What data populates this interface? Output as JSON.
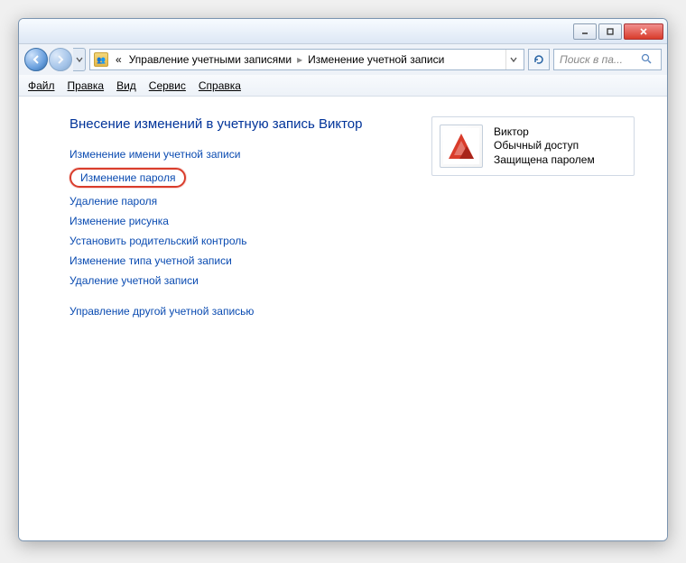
{
  "window_controls": {
    "minimize": "min",
    "maximize": "max",
    "close": "close"
  },
  "breadcrumb": {
    "prefix": "«",
    "item1": "Управление учетными записями",
    "item2": "Изменение учетной записи"
  },
  "search": {
    "placeholder": "Поиск в па..."
  },
  "menu": {
    "file": "Файл",
    "edit": "Правка",
    "view": "Вид",
    "tools": "Сервис",
    "help": "Справка"
  },
  "page": {
    "heading": "Внесение изменений в учетную запись Виктор",
    "links": {
      "rename": "Изменение имени учетной записи",
      "change_pw": "Изменение пароля",
      "remove_pw": "Удаление пароля",
      "change_pic": "Изменение рисунка",
      "parental": "Установить родительский контроль",
      "change_type": "Изменение типа учетной записи",
      "delete": "Удаление учетной записи",
      "other": "Управление другой учетной записью"
    }
  },
  "user": {
    "name": "Виктор",
    "access": "Обычный доступ",
    "status": "Защищена паролем"
  }
}
